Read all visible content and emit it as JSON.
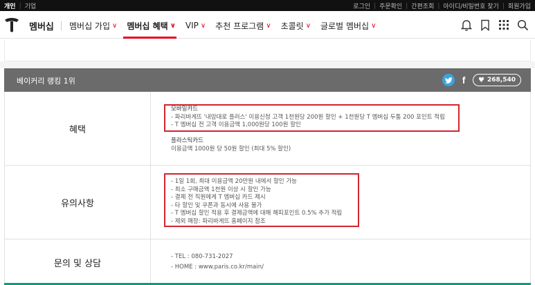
{
  "topbar": {
    "left": [
      "개인",
      "기업"
    ],
    "right": [
      "로그인",
      "주문확인",
      "간편조회",
      "아이디/비밀번호 찾기",
      "회원가입"
    ]
  },
  "nav": {
    "brand": "멤버십",
    "menu": [
      {
        "label": "멤버십 가입",
        "active": false
      },
      {
        "label": "멤버십 혜택",
        "active": true
      },
      {
        "label": "VIP",
        "active": false
      },
      {
        "label": "추천 프로그램",
        "active": false
      },
      {
        "label": "초콜릿",
        "active": false
      },
      {
        "label": "글로벌 멤버십",
        "active": false
      }
    ],
    "icons": [
      "bell-icon",
      "bookmark-icon",
      "grid-icon",
      "search-icon"
    ],
    "accent": "#e8001c"
  },
  "section": {
    "title": "베이커리 랭킹 1위",
    "like_count": "268,540"
  },
  "rows": {
    "benefit": {
      "label": "혜택",
      "mobile_title": "모바일카드",
      "mobile_lines": [
        "- 파리바게뜨 '내맘대로 플러스' 이용신청 고객 1천원당 200원 할인 + 1천원당 T 멤버십 두툼 200 포인트 적립",
        "- T 멤버십 전 고객 이용금액 1,000원당 100원 할인"
      ],
      "plastic_title": "플라스틱카드",
      "plastic_lines": [
        "이용금액 1000원 당 50원 할인 (최대 5% 할인)"
      ]
    },
    "caution": {
      "label": "유의사항",
      "lines": [
        "- 1일 1회, 최대 이용금액 20만원 내에서 할인 가능",
        "- 최소 구매금액 1천원 이상 시 할인 가능",
        "- 결제 전 직원에게 T 멤버십 카드 제시",
        "- 타 할인 및 쿠폰과 동시에 사용 불가",
        "- T 멤버십 할인 적용 후 결제금액에 대해 해피포인트 0.5% 추가 적립",
        "- 제외 매장: 파리바게뜨 홈페이지 참조"
      ]
    },
    "contact": {
      "label": "문의 및 상담",
      "lines": [
        "- TEL : 080-731-2027",
        "- HOME : www.paris.co.kr/main/"
      ]
    }
  },
  "colors": {
    "highlight": "#d1242f",
    "header_bg": "#6b6b6b",
    "twitter": "#3aa4e0"
  }
}
